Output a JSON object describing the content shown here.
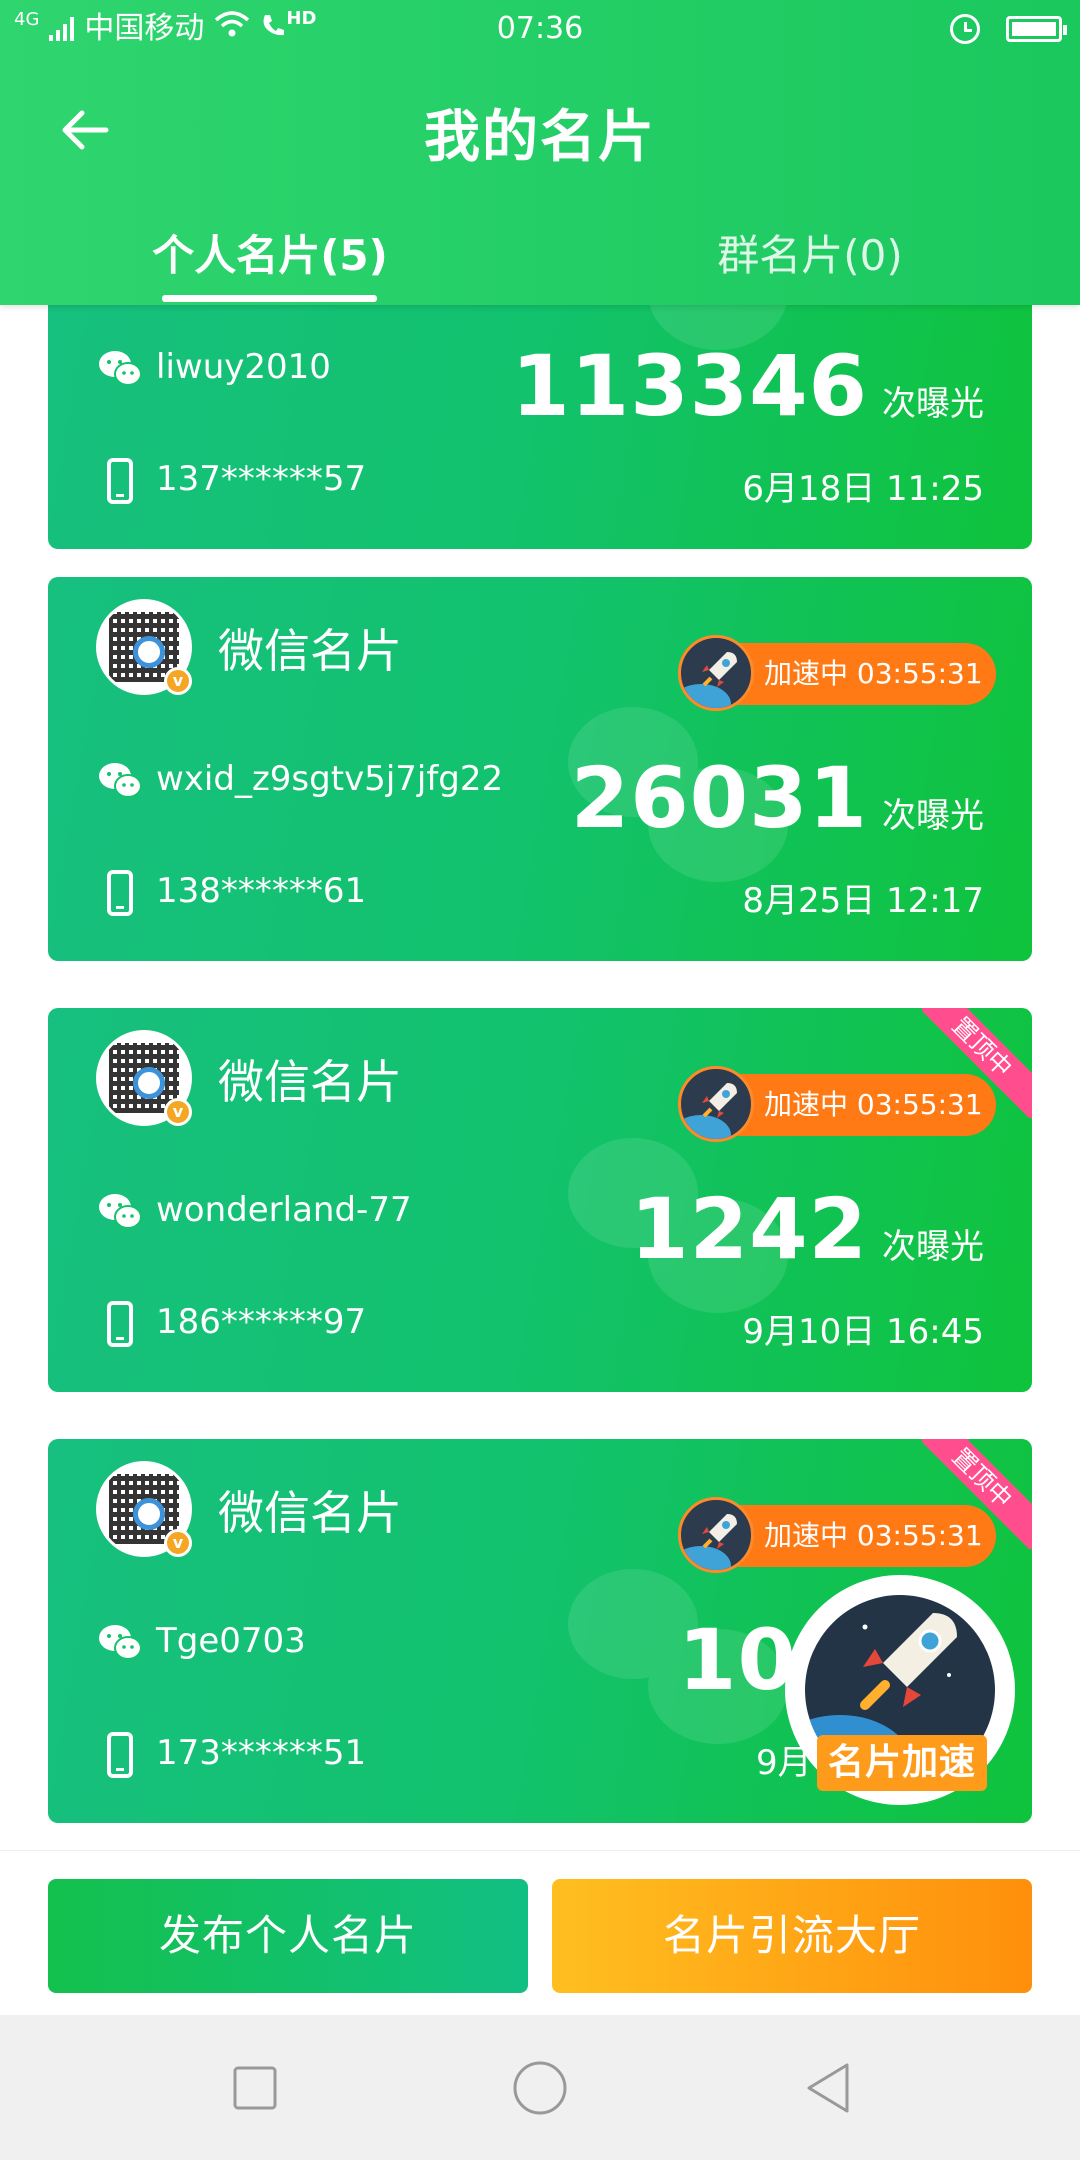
{
  "status_bar": {
    "network": "4G",
    "carrier": "中国移动",
    "hd": "HD",
    "time": "07:36"
  },
  "header": {
    "title": "我的名片",
    "tabs": [
      {
        "label": "个人名片(5)",
        "active": true
      },
      {
        "label": "群名片(0)",
        "active": false
      }
    ]
  },
  "cards": [
    {
      "type": "",
      "wechat_id": "liwuy2010",
      "phone": "137******57",
      "count": "113346",
      "count_unit": "次曝光",
      "date": "6月18日 11:25",
      "boost": "",
      "pinned": ""
    },
    {
      "type": "微信名片",
      "wechat_id": "wxid_z9sgtv5j7jfg22",
      "phone": "138******61",
      "count": "26031",
      "count_unit": "次曝光",
      "date": "8月25日 12:17",
      "boost": "加速中 03:55:31",
      "pinned": ""
    },
    {
      "type": "微信名片",
      "wechat_id": "wonderland-77",
      "phone": "186******97",
      "count": "1242",
      "count_unit": "次曝光",
      "date": "9月10日 16:45",
      "boost": "加速中 03:55:31",
      "pinned": "置顶中"
    },
    {
      "type": "微信名片",
      "wechat_id": "Tge0703",
      "phone": "173******51",
      "count": "102",
      "count_unit": "",
      "date": "9月",
      "boost": "加速中 03:55:31",
      "pinned": "置顶中"
    }
  ],
  "fab": {
    "label": "名片加速"
  },
  "bottom_buttons": {
    "publish": "发布个人名片",
    "hall": "名片引流大厅"
  },
  "colors": {
    "brand_green": "#1ac85e",
    "boost_orange": "#ff7a14",
    "pinned_pink": "#ff4d8d",
    "hall_orange": "#ff9b1a"
  },
  "icons": {
    "back": "arrow-left-icon",
    "wechat": "wechat-icon",
    "phone": "phone-icon",
    "rocket": "rocket-icon",
    "nav_recent": "square-icon",
    "nav_home": "circle-icon",
    "nav_back": "triangle-back-icon"
  }
}
